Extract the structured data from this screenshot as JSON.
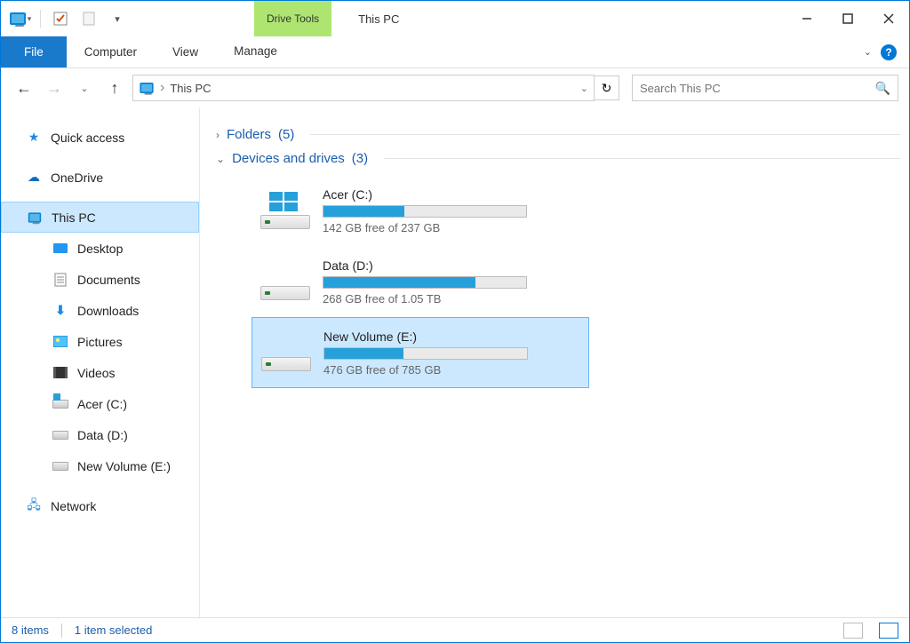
{
  "window": {
    "title": "This PC"
  },
  "ribbon": {
    "contextual": "Drive Tools",
    "file": "File",
    "computer": "Computer",
    "view": "View",
    "manage": "Manage"
  },
  "address": {
    "path": "This PC",
    "separator": "›"
  },
  "search": {
    "placeholder": "Search This PC"
  },
  "sidebar": {
    "quick_access": "Quick access",
    "onedrive": "OneDrive",
    "this_pc": "This PC",
    "desktop": "Desktop",
    "documents": "Documents",
    "downloads": "Downloads",
    "pictures": "Pictures",
    "videos": "Videos",
    "acer_c": "Acer (C:)",
    "data_d": "Data (D:)",
    "new_vol_e": "New Volume (E:)",
    "network": "Network"
  },
  "groups": {
    "folders": {
      "label": "Folders",
      "count": "(5)"
    },
    "devices": {
      "label": "Devices and drives",
      "count": "(3)"
    }
  },
  "drives": {
    "c": {
      "name": "Acer (C:)",
      "free_text": "142 GB free of 237 GB",
      "fill_percent": 40
    },
    "d": {
      "name": "Data (D:)",
      "free_text": "268 GB free of 1.05 TB",
      "fill_percent": 75
    },
    "e": {
      "name": "New Volume (E:)",
      "free_text": "476 GB free of 785 GB",
      "fill_percent": 39
    }
  },
  "status": {
    "items": "8 items",
    "selected": "1 item selected"
  }
}
